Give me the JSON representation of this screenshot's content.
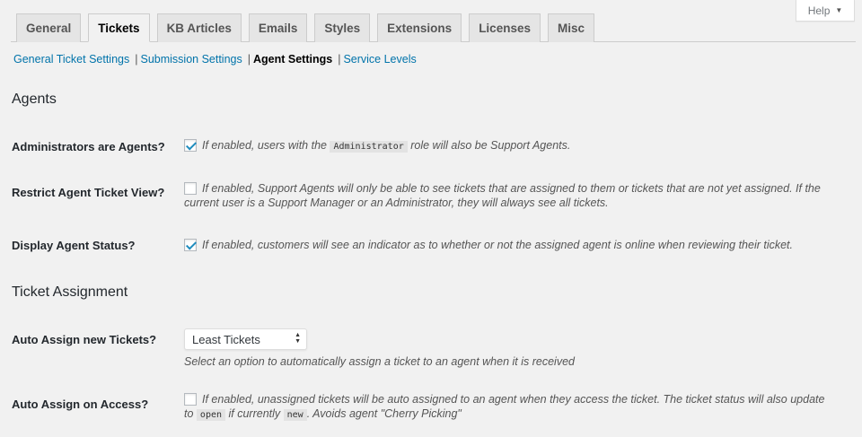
{
  "help": {
    "label": "Help",
    "icon": "caret-down-icon"
  },
  "tabs": [
    {
      "label": "General"
    },
    {
      "label": "Tickets",
      "active": true
    },
    {
      "label": "KB Articles"
    },
    {
      "label": "Emails"
    },
    {
      "label": "Styles"
    },
    {
      "label": "Extensions"
    },
    {
      "label": "Licenses"
    },
    {
      "label": "Misc"
    }
  ],
  "subnav": [
    {
      "label": "General Ticket Settings"
    },
    {
      "label": "Submission Settings"
    },
    {
      "label": "Agent Settings",
      "current": true
    },
    {
      "label": "Service Levels"
    }
  ],
  "sections": {
    "agents": {
      "title": "Agents",
      "admins_are_agents": {
        "label": "Administrators are Agents?",
        "checked": true,
        "desc_before": "If enabled, users with the",
        "code": "Administrator",
        "desc_after": "role will also be Support Agents."
      },
      "restrict_view": {
        "label": "Restrict Agent Ticket View?",
        "checked": false,
        "desc_line1": "If enabled, Support Agents will only be able to see tickets that are assigned to them or tickets that are not yet assigned. If the",
        "desc_line2": "current user is a Support Manager or an Administrator, they will always see all tickets."
      },
      "display_status": {
        "label": "Display Agent Status?",
        "checked": true,
        "desc": "If enabled, customers will see an indicator as to whether or not the assigned agent is online when reviewing their ticket."
      }
    },
    "assignment": {
      "title": "Ticket Assignment",
      "auto_assign_new": {
        "label": "Auto Assign new Tickets?",
        "selected": "Least Tickets",
        "desc": "Select an option to automatically assign a ticket to an agent when it is received"
      },
      "auto_assign_access": {
        "label": "Auto Assign on Access?",
        "checked": false,
        "desc_line1": "If enabled, unassigned tickets will be auto assigned to an agent when they access the ticket. The ticket status will also update",
        "desc_to": "to",
        "code_open": "open",
        "desc_if": "if currently",
        "code_new": "new",
        "desc_end": ". Avoids agent \"Cherry Picking\""
      }
    }
  },
  "colors": {
    "link": "#0073aa",
    "check": "#1e8cbe",
    "background": "#f1f1f1"
  }
}
